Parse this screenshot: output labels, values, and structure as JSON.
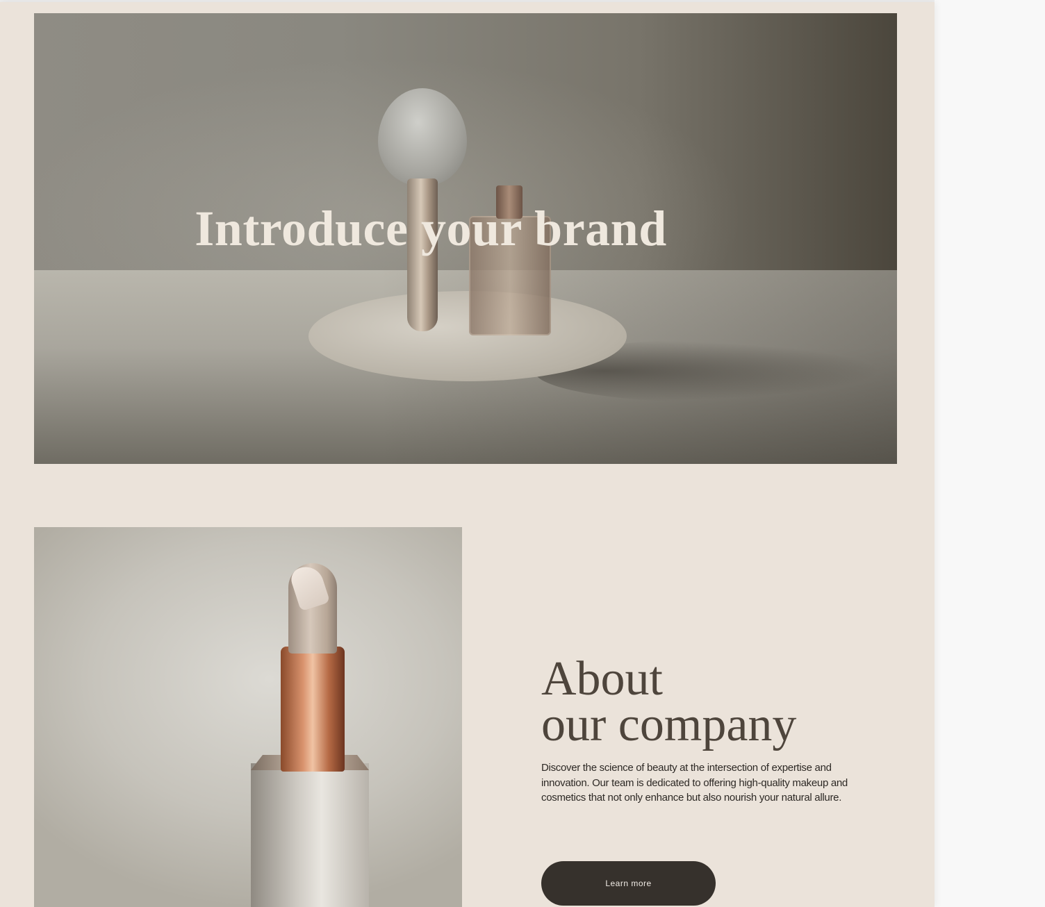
{
  "hero": {
    "title": "Introduce your brand"
  },
  "about": {
    "heading_line1": "About",
    "heading_line2": "our company",
    "body": "Discover the science of beauty at the intersection of expertise and innovation. Our team is dedicated to offering high-quality makeup and cosmetics that not only enhance but also nourish your natural allure.",
    "button_label": "Learn more"
  },
  "colors": {
    "page_background": "#ebe3da",
    "heading": "#4e453c",
    "hero_title": "#efe8de",
    "button_background": "#36312c",
    "button_text": "#f1ece6"
  }
}
